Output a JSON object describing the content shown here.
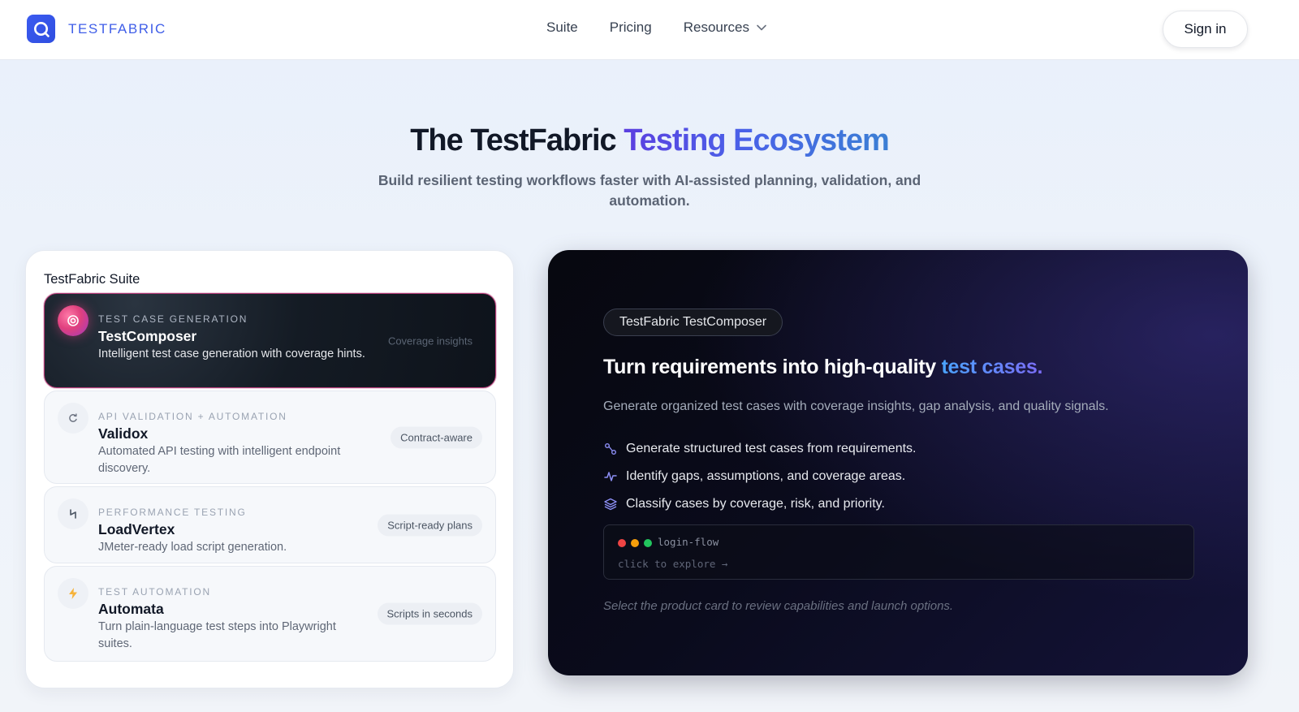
{
  "header": {
    "brand": "TESTFABRIC",
    "nav": [
      {
        "label": "Suite"
      },
      {
        "label": "Pricing"
      },
      {
        "label": "Resources",
        "has_dropdown": true
      }
    ],
    "signin_label": "Sign in"
  },
  "hero": {
    "title_plain": "The TestFabric ",
    "title_accent": "Testing Ecosystem",
    "subtitle": "Build resilient testing workflows faster with AI-assisted planning, validation, and automation."
  },
  "suite": {
    "title": "TestFabric Suite",
    "cards": [
      {
        "category": "TEST CASE GENERATION",
        "name": "TestComposer",
        "description": "Intelligent test case generation with coverage hints.",
        "badge": "Coverage insights",
        "icon": "target-icon",
        "active": true
      },
      {
        "category": "API VALIDATION + AUTOMATION",
        "name": "Validox",
        "description": "Automated API testing with intelligent endpoint discovery.",
        "badge": "Contract-aware",
        "icon": "refresh-icon",
        "active": false
      },
      {
        "category": "PERFORMANCE TESTING",
        "name": "LoadVertex",
        "description": "JMeter-ready load script generation.",
        "badge": "Script-ready plans",
        "icon": "spark-icon",
        "active": false
      },
      {
        "category": "TEST AUTOMATION",
        "name": "Automata",
        "description": "Turn plain-language test steps into Playwright suites.",
        "badge": "Scripts in seconds",
        "icon": "lightning-icon",
        "active": false
      }
    ]
  },
  "detail": {
    "pill": "TestFabric TestComposer",
    "title_plain": "Turn requirements into high-quality ",
    "title_accent": "test cases.",
    "description": "Generate organized test cases with coverage insights, gap analysis, and quality signals.",
    "features": [
      {
        "icon": "route-icon",
        "text": "Generate structured test cases from requirements."
      },
      {
        "icon": "pulse-icon",
        "text": "Identify gaps, assumptions, and coverage areas."
      },
      {
        "icon": "layers-icon",
        "text": "Classify cases by coverage, risk, and priority."
      }
    ],
    "terminal": {
      "file": "login-flow",
      "hint": "click to explore →"
    },
    "note": "Select the product card to review capabilities and launch options."
  },
  "colors": {
    "brand": "#3f5ee8",
    "active_border": "#b23a76",
    "dot_red": "#ef4444",
    "dot_yellow": "#f59e0b",
    "dot_green": "#22c55e"
  }
}
